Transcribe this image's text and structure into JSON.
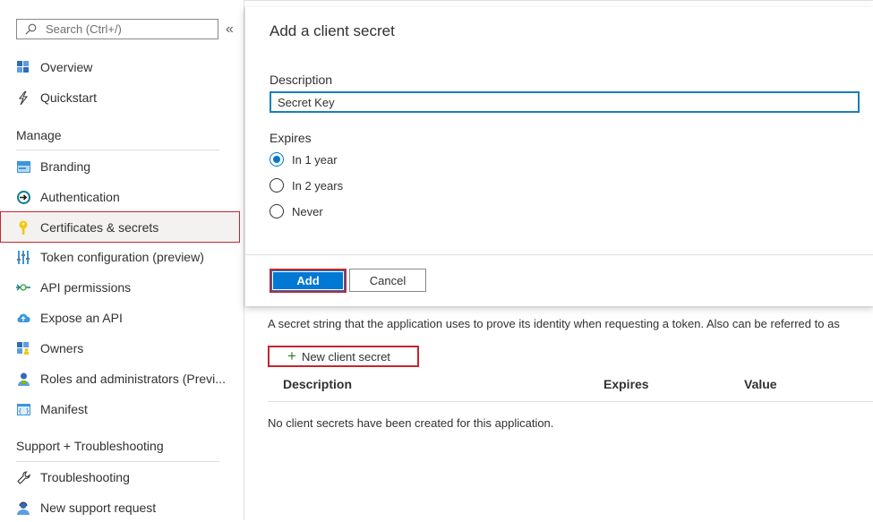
{
  "sidebar": {
    "search_placeholder": "Search (Ctrl+/)",
    "collapse_glyph": "«",
    "items_top": [
      {
        "label": "Overview",
        "icon": "overview-grid-icon"
      },
      {
        "label": "Quickstart",
        "icon": "lightning-icon"
      }
    ],
    "manage_heading": "Manage",
    "manage_items": [
      {
        "label": "Branding",
        "icon": "branding-icon"
      },
      {
        "label": "Authentication",
        "icon": "authentication-icon"
      },
      {
        "label": "Certificates & secrets",
        "icon": "key-icon",
        "selected": true
      },
      {
        "label": "Token configuration (preview)",
        "icon": "token-bars-icon"
      },
      {
        "label": "API permissions",
        "icon": "api-permissions-icon"
      },
      {
        "label": "Expose an API",
        "icon": "cloud-icon"
      },
      {
        "label": "Owners",
        "icon": "owners-icon"
      },
      {
        "label": "Roles and administrators (Previ...",
        "icon": "roles-icon"
      },
      {
        "label": "Manifest",
        "icon": "manifest-icon"
      }
    ],
    "support_heading": "Support + Troubleshooting",
    "support_items": [
      {
        "label": "Troubleshooting",
        "icon": "wrench-icon"
      },
      {
        "label": "New support request",
        "icon": "support-person-icon"
      }
    ]
  },
  "panel": {
    "title": "Add a client secret",
    "description_label": "Description",
    "description_value": "Secret Key",
    "expires_label": "Expires",
    "expires_options": [
      {
        "label": "In 1 year",
        "checked": true
      },
      {
        "label": "In 2 years",
        "checked": false
      },
      {
        "label": "Never",
        "checked": false
      }
    ],
    "add_label": "Add",
    "cancel_label": "Cancel"
  },
  "main": {
    "secret_info": "A secret string that the application uses to prove its identity when requesting a token. Also can be referred to as",
    "new_secret_label": "New client secret",
    "columns": [
      "Description",
      "Expires",
      "Value"
    ],
    "empty_message": "No client secrets have been created for this application."
  },
  "colors": {
    "accent": "#0078d4",
    "highlight_border": "#c4262e",
    "input_border": "#1a7fb8"
  }
}
